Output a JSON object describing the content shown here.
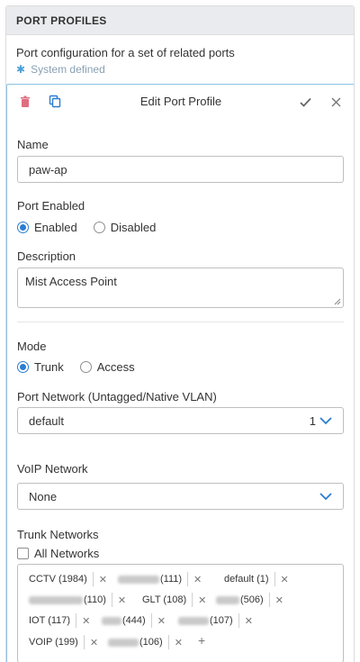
{
  "panel": {
    "title": "PORT PROFILES",
    "description": "Port configuration for a set of related ports",
    "system_defined": "System defined"
  },
  "editor": {
    "title": "Edit Port Profile",
    "name_label": "Name",
    "name_value": "paw-ap",
    "port_enabled_label": "Port Enabled",
    "enabled_option": "Enabled",
    "disabled_option": "Disabled",
    "port_enabled_selected": "Enabled",
    "description_label": "Description",
    "description_value": "Mist Access Point",
    "mode_label": "Mode",
    "trunk_option": "Trunk",
    "access_option": "Access",
    "mode_selected": "Trunk",
    "port_network_label": "Port Network (Untagged/Native VLAN)",
    "port_network_value": "default",
    "port_network_count": "1",
    "voip_label": "VoIP Network",
    "voip_value": "None",
    "trunk_label": "Trunk Networks",
    "all_networks_label": "All Networks",
    "all_networks_checked": false
  },
  "trunk_tags": [
    {
      "text": "CCTV (1984)"
    },
    {
      "text": "(111)"
    },
    {
      "text": "default (1)"
    },
    {
      "text": "(110)"
    },
    {
      "text": "GLT (108)"
    },
    {
      "text": "(506)"
    },
    {
      "text": "IOT (117)"
    },
    {
      "text": "(444)"
    },
    {
      "text": "(107)"
    },
    {
      "text": "VOIP (199)"
    },
    {
      "text": "(106)"
    }
  ],
  "colors": {
    "accent": "#2a7dd1",
    "header_bg": "#e9ebee",
    "card_border": "#8cc3e8",
    "delete_icon": "#e06c7f"
  }
}
